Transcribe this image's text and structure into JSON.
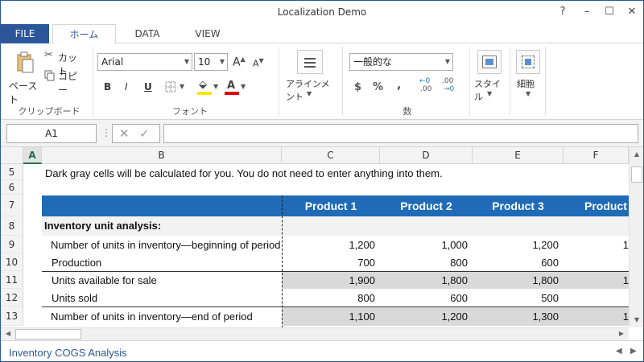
{
  "window": {
    "title": "Localization Demo",
    "help": "?",
    "minimize": "–",
    "restore": "☐",
    "close": "✕"
  },
  "tabs": {
    "file": "FILE",
    "home": "ホーム",
    "data": "DATA",
    "view": "VIEW"
  },
  "ribbon": {
    "clipboard": {
      "paste": "ペースト",
      "cut": "カット",
      "copy": "コピー",
      "group": "クリップボード"
    },
    "font": {
      "family": "Arial",
      "size": "10",
      "grow": "A",
      "shrink": "A",
      "bold": "B",
      "italic": "I",
      "underline": "U",
      "font_color_letter": "A",
      "group": "フォント"
    },
    "alignment": {
      "label": "アラインメント"
    },
    "number": {
      "format": "一般的な",
      "currency": "$",
      "percent": "%",
      "comma": ",",
      "inc_decimal": ".00",
      "dec_decimal": ".00",
      "group": "数"
    },
    "styles": {
      "label": "スタイル"
    },
    "cells": {
      "label": "細胞"
    }
  },
  "formula_bar": {
    "name_box": "A1",
    "separator": "⋮",
    "cancel": "✕",
    "enter": "✓",
    "formula": ""
  },
  "grid": {
    "columns": [
      "A",
      "B",
      "C",
      "D",
      "E",
      "F"
    ],
    "rows": [
      "5",
      "6",
      "7",
      "8",
      "9",
      "10",
      "11",
      "12",
      "13"
    ],
    "note": "Dark gray cells will be calculated for you. You do not need to enter anything into them.",
    "headers": [
      "Product 1",
      "Product 2",
      "Product 3",
      "Product"
    ],
    "section": "Inventory unit analysis:",
    "lines": [
      {
        "label": "Number of units in inventory—beginning of period",
        "values": [
          "1,200",
          "1,000",
          "1,200",
          "1"
        ]
      },
      {
        "label": "Production",
        "values": [
          "700",
          "800",
          "600",
          ""
        ]
      },
      {
        "label": "Units available for sale",
        "values": [
          "1,900",
          "1,800",
          "1,800",
          "1"
        ]
      },
      {
        "label": "Units sold",
        "values": [
          "800",
          "600",
          "500",
          ""
        ]
      },
      {
        "label": "Number of units in inventory—end of period",
        "values": [
          "1,100",
          "1,200",
          "1,300",
          "1"
        ]
      }
    ]
  },
  "sheets": {
    "active": "Inventory COGS Analysis"
  },
  "colors": {
    "accent": "#2b579a",
    "header_band": "#1f6bb8",
    "calc_gray": "#d9d9d9",
    "select_green": "#217346"
  }
}
